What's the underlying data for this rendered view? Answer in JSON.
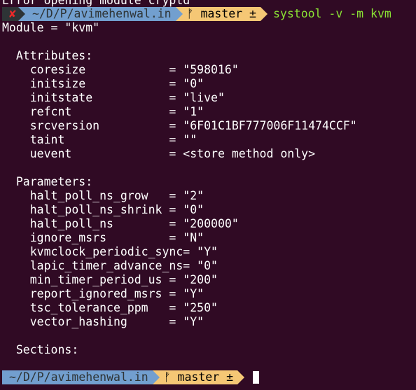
{
  "terminal": {
    "cut_line": "Error opening module cryptd",
    "prompt1": {
      "status_symbol": "✘",
      "cwd": "~/D/P/avimehenwal.in",
      "git_branch": "master ±",
      "command": "systool -v -m kvm"
    },
    "output": [
      "Module = \"kvm\"",
      "",
      "  Attributes:",
      "    coresize            = \"598016\"",
      "    initsize            = \"0\"",
      "    initstate           = \"live\"",
      "    refcnt              = \"1\"",
      "    srcversion          = \"6F01C1BF777006F11474CCF\"",
      "    taint               = \"\"",
      "    uevent              = <store method only>",
      "",
      "  Parameters:",
      "    halt_poll_ns_grow   = \"2\"",
      "    halt_poll_ns_shrink = \"0\"",
      "    halt_poll_ns        = \"200000\"",
      "    ignore_msrs         = \"N\"",
      "    kvmclock_periodic_sync= \"Y\"",
      "    lapic_timer_advance_ns= \"0\"",
      "    min_timer_period_us = \"200\"",
      "    report_ignored_msrs = \"Y\"",
      "    tsc_tolerance_ppm   = \"250\"",
      "    vector_hashing      = \"Y\"",
      "",
      "  Sections:"
    ],
    "prompt2": {
      "cwd": "~/D/P/avimehenwal.in",
      "git_branch": "master ±"
    },
    "colors": {
      "background": "#300a24",
      "status_bg": "#2e3436",
      "status_fg": "#ef2929",
      "dir_bg": "#729fcf",
      "git_bg": "#f5c775",
      "command_fg": "#8ae234"
    },
    "icons": {
      "git_branch_icon": "ᚠ"
    }
  }
}
